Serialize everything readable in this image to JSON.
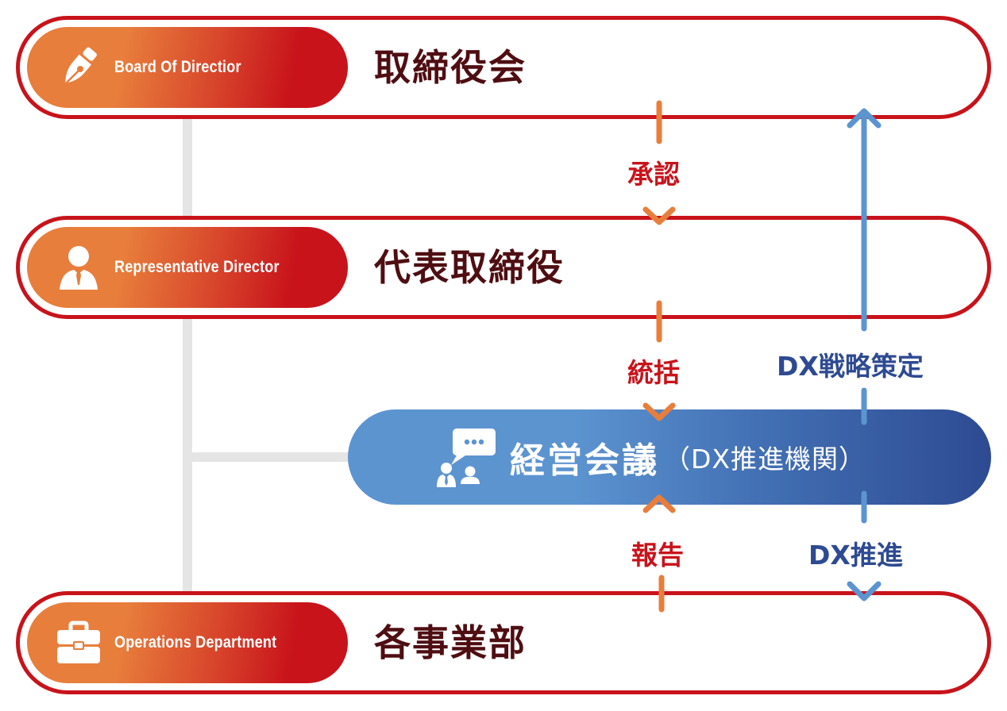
{
  "colors": {
    "ring_red": "#c8131b",
    "badge_orange": "#e87e3c",
    "badge_red": "#c8131b",
    "title_dark": "#4f0e12",
    "hub_light_blue": "#5c94d0",
    "hub_dark_blue": "#2d4a92",
    "arrow_orange": "#e87e3c",
    "arrow_blue": "#5c94d0",
    "connector_gray": "#e5e5e5"
  },
  "levels": [
    {
      "id": "board",
      "en": "Board Of Directior",
      "jp": "取締役会",
      "icon": "fountain-pen-icon"
    },
    {
      "id": "rep",
      "en": "Representative Director",
      "jp": "代表取締役",
      "icon": "businessman-icon"
    },
    {
      "id": "ops",
      "en": "Operations Department",
      "jp": "各事業部",
      "icon": "briefcase-icon"
    }
  ],
  "hub": {
    "title": "経営会議",
    "subtitle": "（DX推進機関）",
    "icon": "meeting-chat-icon"
  },
  "flows": {
    "approval": "承認",
    "oversight": "統括",
    "report": "報告",
    "dx_strategy": "DX戦略策定",
    "dx_promotion": "DX推進"
  }
}
